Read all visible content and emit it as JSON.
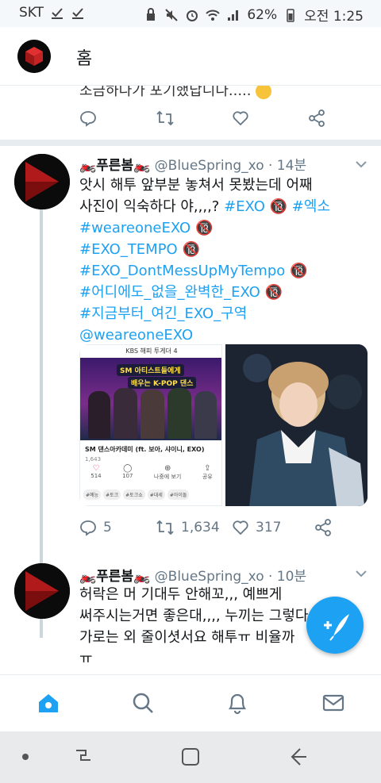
{
  "status_bar": {
    "carrier": "SKT",
    "battery": "62%",
    "time": "오전 1:25"
  },
  "header": {
    "title": "홈"
  },
  "previous_tweet": {
    "text": "조금하다가 포기했답니다....."
  },
  "tweet1": {
    "display_name": "🏍️푸른봄🏍️",
    "handle": "@BlueSpring_xo",
    "time": "· 14분",
    "body_line1": "앗시 해투 앞부분 놓쳐서 못봤는데 어째",
    "body_line2_text": "사진이 익숙하다 야,,,,? ",
    "tags": [
      "#EXO",
      "#엑소",
      "#weareoneEXO",
      "#EXO_TEMPO",
      "#EXO_DontMessUpMyTempo",
      "#어디에도_없을_완벽한_EXO",
      "#지금부터_여긴_EXO_구역",
      "@weareoneEXO"
    ],
    "media": {
      "kbs_header": "KBS 해피 투게더 4",
      "banner_line1": "SM 아티스트들에게",
      "banner_line2": "배우는 K-POP 댄스",
      "caption": "SM 댄스아카데미 (ft. 보아, 샤이니, EXO)",
      "views": "1,643",
      "like_count": "514",
      "comment_count": "107",
      "share_label": "나중에 보기",
      "share2_label": "공유",
      "chips": [
        "#예능",
        "#토크",
        "#토크쇼",
        "#대세",
        "#아이돌"
      ]
    },
    "replies": "5",
    "retweets": "1,634",
    "likes": "317"
  },
  "tweet2": {
    "display_name": "🏍️푸른봄🏍️",
    "handle": "@BlueSpring_xo",
    "time": "· 10분",
    "line1": "허락은 머 기대두 안해꼬,,, 예쁘게",
    "line2": "써주시는거면 좋은대,,,, 누끼는 그렇다",
    "line3": "가로는 외 줄이셧서요  해투ㅠ 비율까",
    "line4": "ㅠ"
  },
  "colors": {
    "accent": "#1da1f2",
    "text": "#14171a",
    "secondary": "#657786"
  }
}
